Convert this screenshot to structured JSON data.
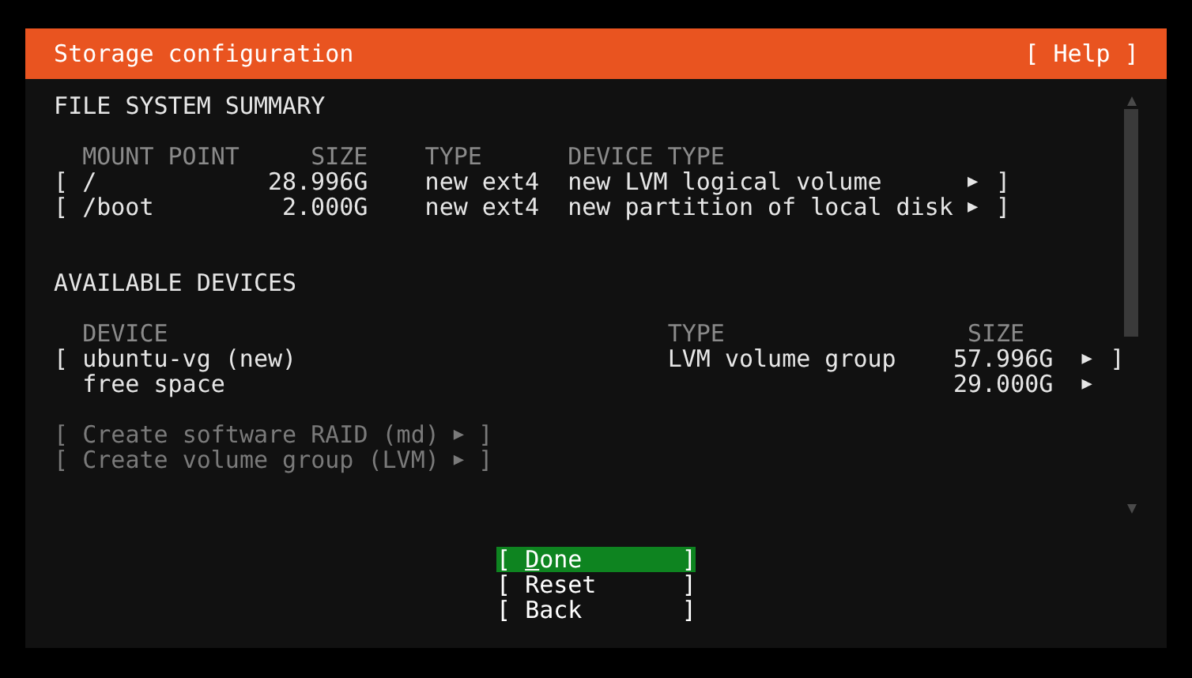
{
  "window": {
    "title": "Storage configuration",
    "help": "[ Help ]"
  },
  "file_system_summary": {
    "heading": "FILE SYSTEM SUMMARY",
    "columns": [
      "MOUNT POINT",
      "SIZE",
      "TYPE",
      "DEVICE TYPE"
    ],
    "rows": [
      {
        "bracket_open": "[",
        "mount_point": "/",
        "size": "28.996G",
        "type": "new ext4",
        "device_type": "new LVM logical volume",
        "arrow": "▶",
        "bracket_close": "]"
      },
      {
        "bracket_open": "[",
        "mount_point": "/boot",
        "size": "2.000G",
        "type": "new ext4",
        "device_type": "new partition of local disk",
        "arrow": "▶",
        "bracket_close": "]"
      }
    ]
  },
  "available_devices": {
    "heading": "AVAILABLE DEVICES",
    "columns": [
      "DEVICE",
      "TYPE",
      "SIZE"
    ],
    "rows": [
      {
        "bracket_open": "[",
        "device": "ubuntu-vg (new)",
        "type": "LVM volume group",
        "size": "57.996G",
        "arrow": "▶",
        "bracket_close": "]"
      },
      {
        "device": "free space",
        "size": "29.000G",
        "arrow": "▶"
      }
    ],
    "actions": [
      {
        "bracket_open": "[",
        "label": "Create software RAID (md)",
        "arrow": "▶",
        "bracket_close": "]",
        "disabled": true
      },
      {
        "bracket_open": "[",
        "label": "Create volume group (LVM)",
        "arrow": "▶",
        "bracket_close": "]",
        "disabled": true
      }
    ]
  },
  "buttons": [
    {
      "bracket_open": "[",
      "label": "Done",
      "bracket_close": "]",
      "selected": true
    },
    {
      "bracket_open": "[",
      "label": "Reset",
      "bracket_close": "]",
      "selected": false
    },
    {
      "bracket_open": "[",
      "label": "Back",
      "bracket_close": "]",
      "selected": false
    }
  ]
}
